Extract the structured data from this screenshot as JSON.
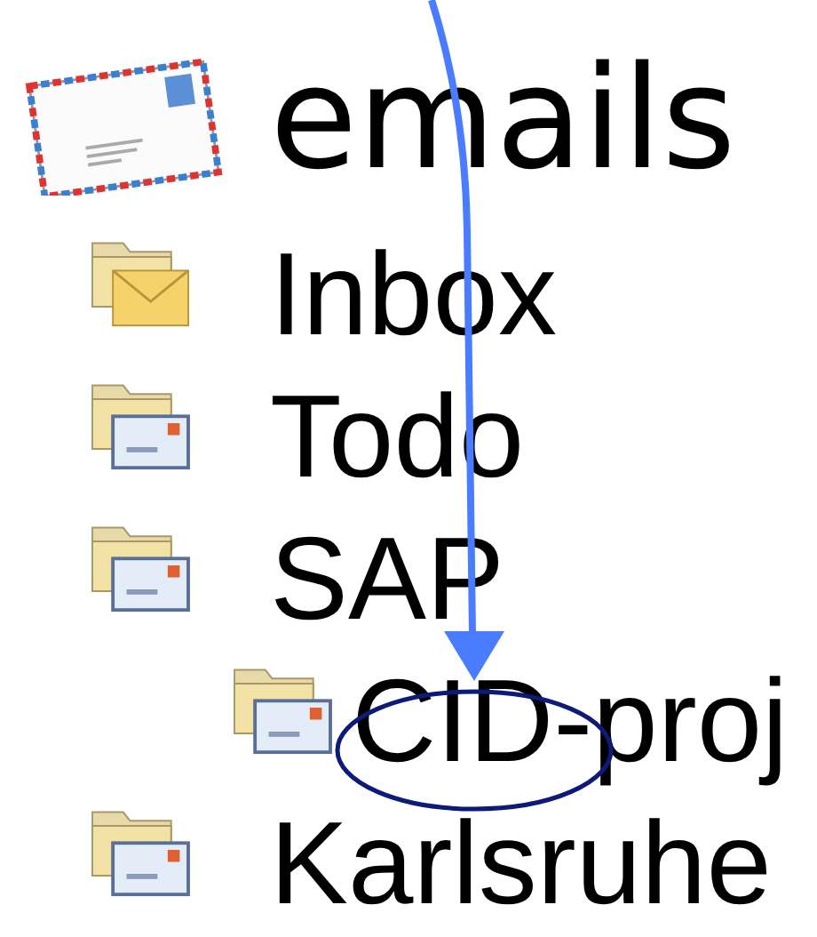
{
  "root": {
    "label": "emails"
  },
  "folders": [
    {
      "label": "Inbox",
      "kind": "inbox"
    },
    {
      "label": "Todo",
      "kind": "folder"
    },
    {
      "label": "SAP",
      "kind": "folder",
      "children": [
        {
          "label": "CID-proj",
          "kind": "folder"
        }
      ]
    },
    {
      "label": "Karlsruhe",
      "kind": "folder"
    }
  ]
}
